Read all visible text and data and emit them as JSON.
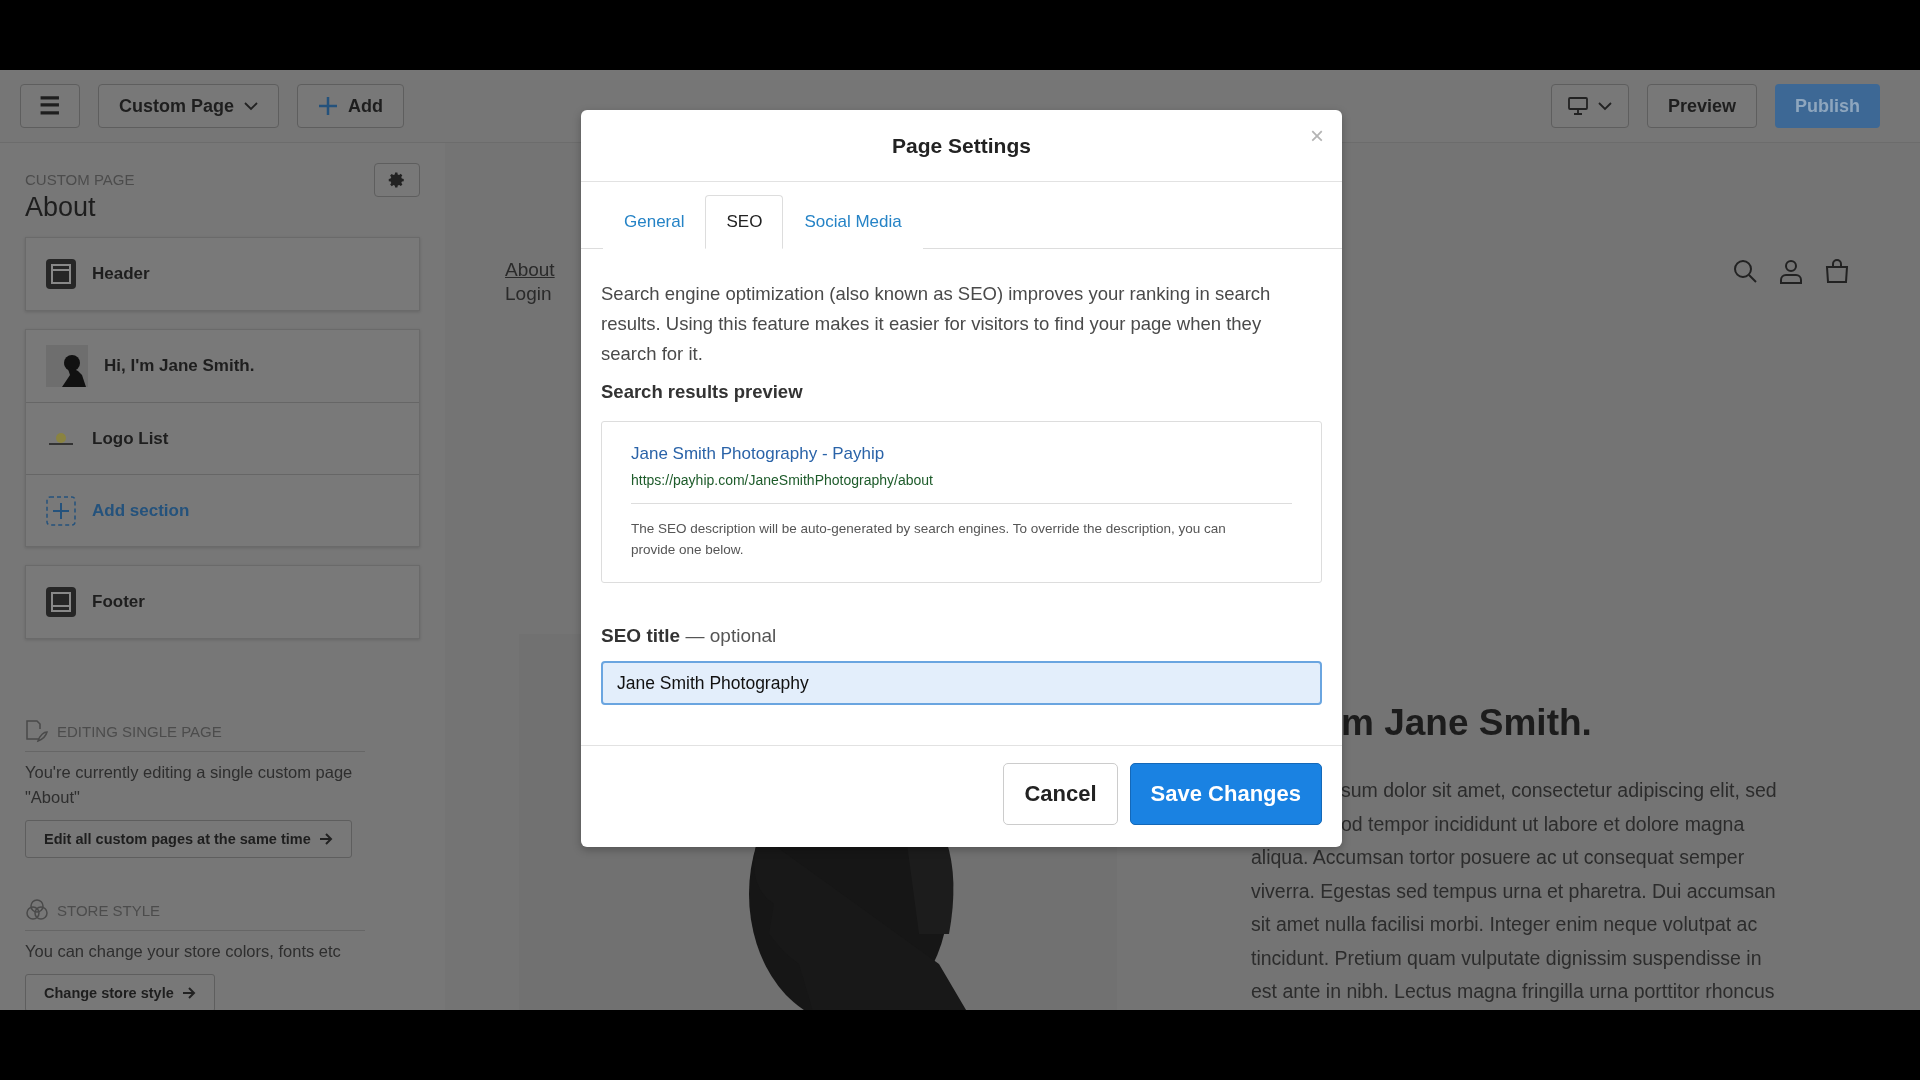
{
  "top_bar": {
    "menu_label": "☰",
    "page_selector": "Custom Page",
    "add_button": "Add",
    "device_toggle": {
      "kind": "desktop",
      "expanded": false
    },
    "preview_button": "Preview",
    "publish_button": "Publish"
  },
  "sidebar": {
    "eyebrow": "CUSTOM PAGE",
    "title": "About",
    "groups": [
      [
        {
          "kind": "header",
          "label": "Header"
        }
      ],
      [
        {
          "label": "Hi, I'm Jane Smith."
        },
        {
          "kind": "logo",
          "label": "Logo List"
        },
        {
          "kind": "add",
          "label": "Add section"
        }
      ],
      [
        {
          "kind": "footer",
          "label": "Footer"
        }
      ]
    ],
    "info_blocks": [
      {
        "kind": "edit",
        "heading": "EDITING SINGLE PAGE",
        "text": "You're currently editing a single custom page \"About\"",
        "button": "Edit all custom pages at the same time"
      },
      {
        "kind": "style",
        "heading": "STORE STYLE",
        "text": "You can change your store colors, fonts etc",
        "button": "Change store style"
      }
    ]
  },
  "site_preview": {
    "nav_links": [
      {
        "label": "About",
        "selected": true
      },
      {
        "label": "Login",
        "selected": false
      }
    ],
    "heading": "m Jane Smith.",
    "paragraph_lines": [
      "sum dolor sit amet, consectetur adipiscing elit, sed",
      "od tempor incididunt ut labore et dolore magna",
      "aliqua. Accumsan tortor posuere ac ut consequat semper",
      "viverra. Egestas sed tempus urna et pharetra. Dui accumsan",
      "sit amet nulla facilisi morbi. Integer enim neque volutpat ac",
      "tincidunt. Pretium quam vulputate dignissim suspendisse in",
      "est ante in nibh. Lectus magna fringilla urna porttitor rhoncus"
    ]
  },
  "modal": {
    "title": "Page Settings",
    "close": "×",
    "tabs": [
      {
        "label": "General",
        "selected": false
      },
      {
        "label": "SEO",
        "selected": true
      },
      {
        "label": "Social Media",
        "selected": false
      }
    ],
    "description": "Search engine optimization (also known as SEO) improves your ranking in search results. Using this feature makes it easier for visitors to find your page when they search for it.",
    "preview_heading": "Search results preview",
    "preview": {
      "title": "Jane Smith Photography - Payhip",
      "url": "https://payhip.com/JaneSmithPhotography/about",
      "note": "The SEO description will be auto-generated by search engines. To override the description, you can provide one below."
    },
    "field": {
      "label": "SEO title",
      "suffix": "— optional",
      "value": "Jane Smith Photography"
    },
    "buttons": {
      "cancel": "Cancel",
      "save": "Save Changes"
    }
  }
}
